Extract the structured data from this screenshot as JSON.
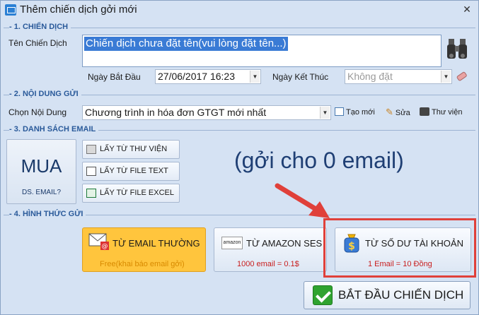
{
  "window": {
    "title": "Thêm chiến dịch gởi mới",
    "close_glyph": "✕"
  },
  "section1": {
    "header": "- 1. CHIẾN DỊCH",
    "campaign_name_label": "Tên Chiến Dịch",
    "campaign_name_value": "Chiến dịch chưa đặt tên(vui lòng đặt tên...)",
    "start_date_label": "Ngày Bắt Đầu",
    "start_date_value": "27/06/2017  16:23",
    "end_date_label": "Ngày Kết Thúc",
    "end_date_placeholder": "Không đặt"
  },
  "section2": {
    "header": "- 2. NỘI DUNG GỬI",
    "content_label": "Chọn Nội Dung",
    "content_value": "Chương trình in hóa đơn GTGT mới nhất",
    "new_label": "Tạo mới",
    "edit_label": "Sửa",
    "library_label": "Thư viện"
  },
  "section3": {
    "header": "- 3. DANH SÁCH EMAIL",
    "buy_big": "MUA",
    "buy_small": "DS. EMAIL?",
    "from_library": "LẤY TỪ THƯ VIỆN",
    "from_text": "LẤY TỪ FILE TEXT",
    "from_excel": "LẤY TỪ FILE EXCEL",
    "send_count": "(gởi cho 0 email)"
  },
  "section4": {
    "header": "- 4. HÌNH THỨC GỬI",
    "methods": [
      {
        "title": "TỪ EMAIL THƯỜNG",
        "sub": "Free(khai báo email gởi)"
      },
      {
        "title": "TỪ AMAZON SES",
        "sub": "1000 email = 0.1$",
        "logo": "amazon"
      },
      {
        "title": "TỪ SỐ DƯ TÀI KHOẢN",
        "sub": "1 Email = 10 Đồng"
      }
    ]
  },
  "start_button": "BẮT ĐẦU CHIẾN DỊCH",
  "colors": {
    "window_bg": "#d5e2f3",
    "section_header": "#2a5a9a",
    "selected_method_bg": "#ffc53d",
    "highlight_red": "#e0403a",
    "sub_text_red": "#c81e1e"
  }
}
